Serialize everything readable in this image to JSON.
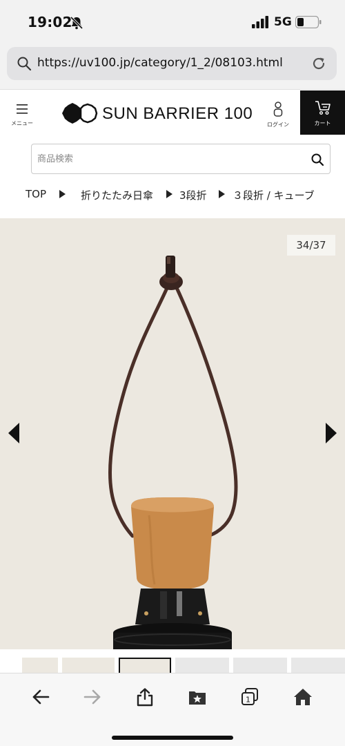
{
  "status_bar": {
    "time": "19:02",
    "network": "5G",
    "icons": [
      "bell-slash-icon",
      "signal-icon",
      "battery-icon"
    ]
  },
  "browser": {
    "url": "https://uv100.jp/category/1_2/08103.html",
    "icons": [
      "search-icon",
      "reload-icon"
    ]
  },
  "header": {
    "menu_label": "メニュー",
    "logo_text": "SUN BARRIER 100",
    "login_label": "ログイン",
    "cart_label": "カート"
  },
  "search": {
    "placeholder": "商品検索"
  },
  "breadcrumb": {
    "items": [
      "TOP",
      "折りたたみ日傘",
      "3段折",
      "３段折 / キューブ"
    ]
  },
  "gallery": {
    "counter": "34/37",
    "current": 34,
    "total": 37,
    "background_color": "#ece8e0"
  },
  "toolbar": {
    "icons": [
      "back-arrow-icon",
      "forward-arrow-icon",
      "share-icon",
      "bookmarks-icon",
      "tabs-icon",
      "home-icon"
    ],
    "tab_count": "1"
  },
  "colors": {
    "cart_bg": "#111111",
    "strap": "#4a2f28",
    "handle": "#c98a4a"
  }
}
